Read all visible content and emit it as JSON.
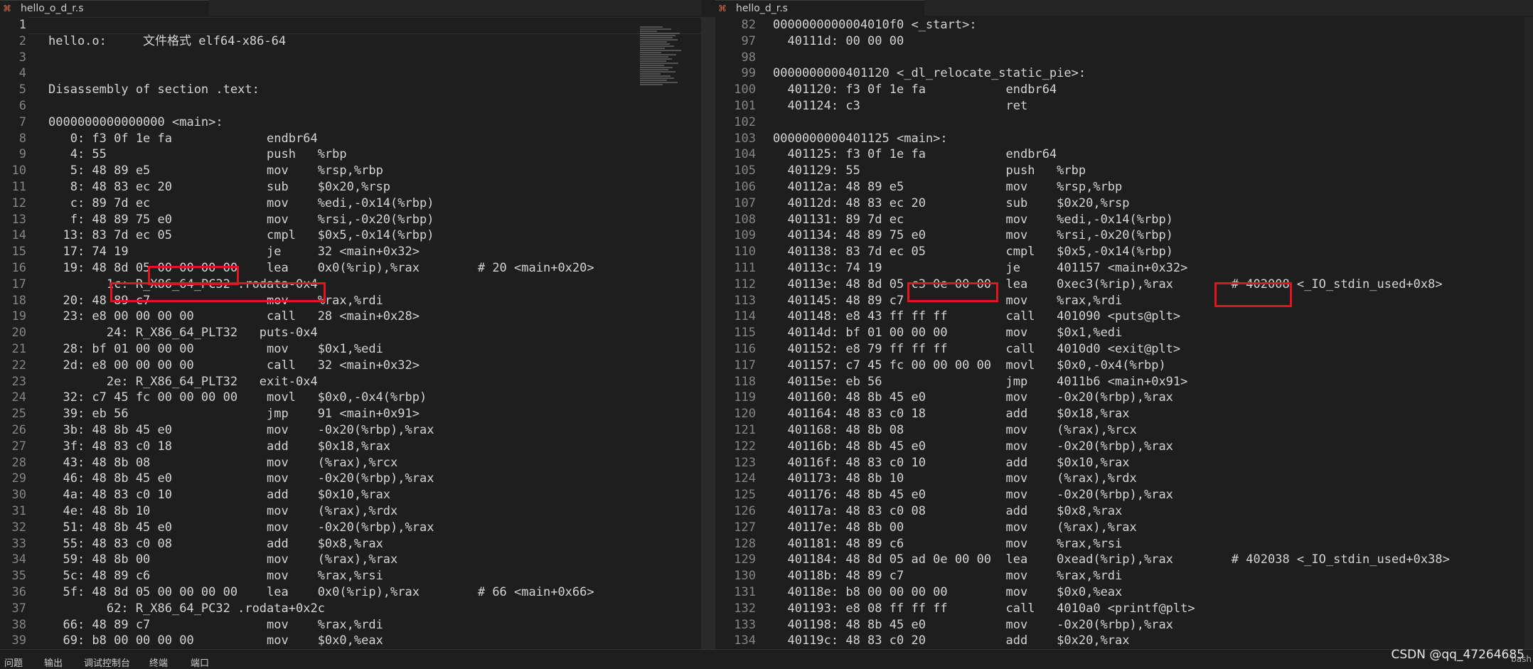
{
  "left_editor": {
    "tab_label": "hello_o_d_r.s",
    "tab_icon": "assembly-file-icon",
    "current_line": "1",
    "lines": [
      [
        "1",
        ""
      ],
      [
        "2",
        "hello.o:     文件格式 elf64-x86-64"
      ],
      [
        "3",
        ""
      ],
      [
        "4",
        ""
      ],
      [
        "5",
        "Disassembly of section .text:"
      ],
      [
        "6",
        ""
      ],
      [
        "7",
        "0000000000000000 <main>:"
      ],
      [
        "8",
        "   0: f3 0f 1e fa             endbr64"
      ],
      [
        "9",
        "   4: 55                      push   %rbp"
      ],
      [
        "10",
        "   5: 48 89 e5                mov    %rsp,%rbp"
      ],
      [
        "11",
        "   8: 48 83 ec 20             sub    $0x20,%rsp"
      ],
      [
        "12",
        "   c: 89 7d ec                mov    %edi,-0x14(%rbp)"
      ],
      [
        "13",
        "   f: 48 89 75 e0             mov    %rsi,-0x20(%rbp)"
      ],
      [
        "14",
        "  13: 83 7d ec 05             cmpl   $0x5,-0x14(%rbp)"
      ],
      [
        "15",
        "  17: 74 19                   je     32 <main+0x32>"
      ],
      [
        "16",
        "  19: 48 8d 05 00 00 00 00    lea    0x0(%rip),%rax        # 20 <main+0x20>"
      ],
      [
        "17",
        "        1c: R_X86_64_PC32 .rodata-0x4"
      ],
      [
        "18",
        "  20: 48 89 c7                mov    %rax,%rdi"
      ],
      [
        "19",
        "  23: e8 00 00 00 00          call   28 <main+0x28>"
      ],
      [
        "20",
        "        24: R_X86_64_PLT32   puts-0x4"
      ],
      [
        "21",
        "  28: bf 01 00 00 00          mov    $0x1,%edi"
      ],
      [
        "22",
        "  2d: e8 00 00 00 00          call   32 <main+0x32>"
      ],
      [
        "23",
        "        2e: R_X86_64_PLT32   exit-0x4"
      ],
      [
        "24",
        "  32: c7 45 fc 00 00 00 00    movl   $0x0,-0x4(%rbp)"
      ],
      [
        "25",
        "  39: eb 56                   jmp    91 <main+0x91>"
      ],
      [
        "26",
        "  3b: 48 8b 45 e0             mov    -0x20(%rbp),%rax"
      ],
      [
        "27",
        "  3f: 48 83 c0 18             add    $0x18,%rax"
      ],
      [
        "28",
        "  43: 48 8b 08                mov    (%rax),%rcx"
      ],
      [
        "29",
        "  46: 48 8b 45 e0             mov    -0x20(%rbp),%rax"
      ],
      [
        "30",
        "  4a: 48 83 c0 10             add    $0x10,%rax"
      ],
      [
        "31",
        "  4e: 48 8b 10                mov    (%rax),%rdx"
      ],
      [
        "32",
        "  51: 48 8b 45 e0             mov    -0x20(%rbp),%rax"
      ],
      [
        "33",
        "  55: 48 83 c0 08             add    $0x8,%rax"
      ],
      [
        "34",
        "  59: 48 8b 00                mov    (%rax),%rax"
      ],
      [
        "35",
        "  5c: 48 89 c6                mov    %rax,%rsi"
      ],
      [
        "36",
        "  5f: 48 8d 05 00 00 00 00    lea    0x0(%rip),%rax        # 66 <main+0x66>"
      ],
      [
        "37",
        "        62: R_X86_64_PC32 .rodata+0x2c"
      ],
      [
        "38",
        "  66: 48 89 c7                mov    %rax,%rdi"
      ],
      [
        "39",
        "  69: b8 00 00 00 00          mov    $0x0,%eax"
      ]
    ]
  },
  "right_editor": {
    "tab_label": "hello_d_r.s",
    "tab_icon": "assembly-file-icon",
    "lines": [
      [
        "82",
        "0000000000004010f0 <_start>:"
      ],
      [
        "97",
        "  40111d: 00 00 00"
      ],
      [
        "98",
        ""
      ],
      [
        "99",
        "0000000000401120 <_dl_relocate_static_pie>:"
      ],
      [
        "100",
        "  401120: f3 0f 1e fa           endbr64"
      ],
      [
        "101",
        "  401124: c3                    ret"
      ],
      [
        "102",
        ""
      ],
      [
        "103",
        "0000000000401125 <main>:"
      ],
      [
        "104",
        "  401125: f3 0f 1e fa           endbr64"
      ],
      [
        "105",
        "  401129: 55                    push   %rbp"
      ],
      [
        "106",
        "  40112a: 48 89 e5              mov    %rsp,%rbp"
      ],
      [
        "107",
        "  40112d: 48 83 ec 20           sub    $0x20,%rsp"
      ],
      [
        "108",
        "  401131: 89 7d ec              mov    %edi,-0x14(%rbp)"
      ],
      [
        "109",
        "  401134: 48 89 75 e0           mov    %rsi,-0x20(%rbp)"
      ],
      [
        "110",
        "  401138: 83 7d ec 05           cmpl   $0x5,-0x14(%rbp)"
      ],
      [
        "111",
        "  40113c: 74 19                 je     401157 <main+0x32>"
      ],
      [
        "112",
        "  40113e: 48 8d 05 c3 0e 00 00  lea    0xec3(%rip),%rax        # 402008 <_IO_stdin_used+0x8>"
      ],
      [
        "113",
        "  401145: 48 89 c7              mov    %rax,%rdi"
      ],
      [
        "114",
        "  401148: e8 43 ff ff ff        call   401090 <puts@plt>"
      ],
      [
        "115",
        "  40114d: bf 01 00 00 00        mov    $0x1,%edi"
      ],
      [
        "116",
        "  401152: e8 79 ff ff ff        call   4010d0 <exit@plt>"
      ],
      [
        "117",
        "  401157: c7 45 fc 00 00 00 00  movl   $0x0,-0x4(%rbp)"
      ],
      [
        "118",
        "  40115e: eb 56                 jmp    4011b6 <main+0x91>"
      ],
      [
        "119",
        "  401160: 48 8b 45 e0           mov    -0x20(%rbp),%rax"
      ],
      [
        "120",
        "  401164: 48 83 c0 18           add    $0x18,%rax"
      ],
      [
        "121",
        "  401168: 48 8b 08              mov    (%rax),%rcx"
      ],
      [
        "122",
        "  40116b: 48 8b 45 e0           mov    -0x20(%rbp),%rax"
      ],
      [
        "123",
        "  40116f: 48 83 c0 10           add    $0x10,%rax"
      ],
      [
        "124",
        "  401173: 48 8b 10              mov    (%rax),%rdx"
      ],
      [
        "125",
        "  401176: 48 8b 45 e0           mov    -0x20(%rbp),%rax"
      ],
      [
        "126",
        "  40117a: 48 83 c0 08           add    $0x8,%rax"
      ],
      [
        "127",
        "  40117e: 48 8b 00              mov    (%rax),%rax"
      ],
      [
        "128",
        "  401181: 48 89 c6              mov    %rax,%rsi"
      ],
      [
        "129",
        "  401184: 48 8d 05 ad 0e 00 00  lea    0xead(%rip),%rax        # 402038 <_IO_stdin_used+0x38>"
      ],
      [
        "130",
        "  40118b: 48 89 c7              mov    %rax,%rdi"
      ],
      [
        "131",
        "  40118e: b8 00 00 00 00        mov    $0x0,%eax"
      ],
      [
        "132",
        "  401193: e8 08 ff ff ff        call   4010a0 <printf@plt>"
      ],
      [
        "133",
        "  401198: 48 8b 45 e0           mov    -0x20(%rbp),%rax"
      ],
      [
        "134",
        "  40119c: 48 83 c0 20           add    $0x20,%rax"
      ]
    ]
  },
  "highlight_color": "#e4141e",
  "bottom_panel": {
    "tabs": [
      "问题",
      "输出",
      "调试控制台",
      "终端",
      "端口"
    ],
    "right_text": "bash"
  },
  "watermark": "CSDN @qq_47264685"
}
